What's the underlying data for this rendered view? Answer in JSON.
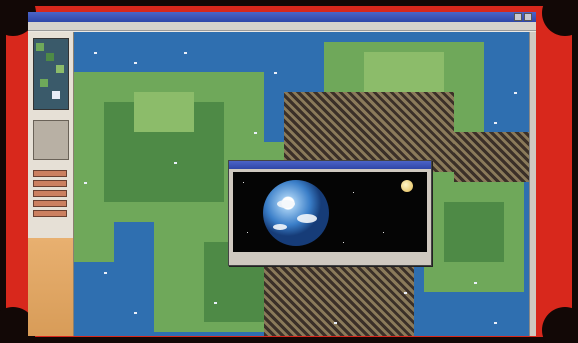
{
  "window": {
    "title": ""
  },
  "menu": {
    "items": [
      "",
      "",
      "",
      "",
      "",
      ""
    ]
  },
  "sidebar": {
    "minimap_label": "minimap",
    "buttons": [
      "",
      "",
      "",
      "",
      ""
    ]
  },
  "dialog": {
    "caption": ""
  },
  "colors": {
    "ocean": "#2f6fb0",
    "land": "#6fa85a",
    "hills": "#3b3028",
    "frame": "#d8281c",
    "title_bar": "#2f46a8"
  },
  "icons": [
    "earth-image",
    "moon-icon",
    "close-icon"
  ]
}
